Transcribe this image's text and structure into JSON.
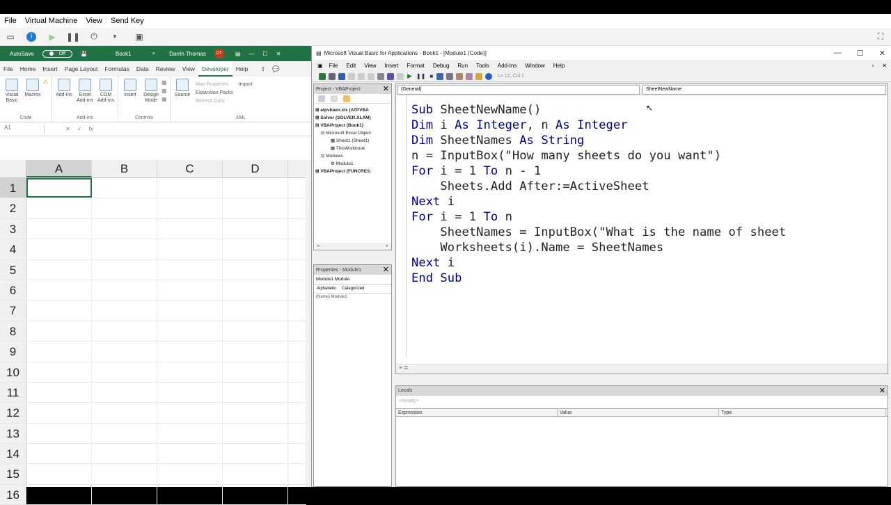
{
  "vm": {
    "menu": [
      "File",
      "Virtual Machine",
      "View",
      "Send Key"
    ]
  },
  "excel": {
    "autosave_label": "AutoSave",
    "autosave_state": "Off",
    "book_name": "Book1",
    "user_name": "Darrin Thomas",
    "user_initials": "DT",
    "tabs": [
      "File",
      "Home",
      "Insert",
      "Page Layout",
      "Formulas",
      "Data",
      "Review",
      "View",
      "Developer",
      "Help"
    ],
    "active_tab": "Developer",
    "ribbon": {
      "code_items": [
        "Visual Basic",
        "Macros"
      ],
      "code_label": "Code",
      "addins_items": [
        "Add-ins",
        "Excel Add-ins",
        "COM Add-ins"
      ],
      "addins_label": "Add-ins",
      "controls_items": [
        "Insert",
        "Design Mode"
      ],
      "controls_label": "Controls",
      "source_label": "Source",
      "xml_items": [
        "Map Properties",
        "Expansion Packs",
        "Refresh Data"
      ],
      "import_label": "Import",
      "xml_label": "XML"
    },
    "namebox": "A1",
    "fx": "fx",
    "columns": [
      "A",
      "B",
      "C",
      "D"
    ],
    "rows": [
      "1",
      "2",
      "3",
      "4",
      "5",
      "6",
      "7",
      "8",
      "9",
      "10",
      "11",
      "12",
      "13",
      "14",
      "15",
      "16"
    ]
  },
  "vba": {
    "title": "Microsoft Visual Basic for Applications - Book1 - [Module1 (Code)]",
    "menu": [
      "File",
      "Edit",
      "View",
      "Insert",
      "Format",
      "Debug",
      "Run",
      "Tools",
      "Add-Ins",
      "Window",
      "Help"
    ],
    "cursor_pos": "Ln 12, Col 1",
    "project_title": "Project - VBAProject",
    "tree": [
      "atpvbaen.xls (ATPVBA",
      "Solver (SOLVER.XLAM)",
      "VBAProject (Book1)",
      "Microsoft Excel Object",
      "Sheet1 (Sheet1)",
      "ThisWorkbook",
      "Modules",
      "Module1",
      "VBAProject (FUNCRES."
    ],
    "properties_title": "Properties - Module1",
    "prop_combo": "Module1 Module",
    "prop_tabs": [
      "Alphabetic",
      "Categorized"
    ],
    "prop_name_row": "(Name) Module1",
    "combo_general": "(General)",
    "combo_proc": "SheetNewName",
    "code": [
      "Sub SheetNewName()",
      "Dim i As Integer, n As Integer",
      "Dim SheetNames As String",
      "n = InputBox(\"How many sheets do you want\")",
      "For i = 1 To n - 1",
      "    Sheets.Add After:=ActiveSheet",
      "Next i",
      "For i = 1 To n",
      "    SheetNames = InputBox(\"What is the name of sheet",
      "    Worksheets(i).Name = SheetNames",
      "Next i",
      "End Sub"
    ],
    "locals_title": "Locals",
    "locals_ready": "<Ready>",
    "locals_cols": [
      "Expression",
      "Value",
      "Type"
    ]
  }
}
